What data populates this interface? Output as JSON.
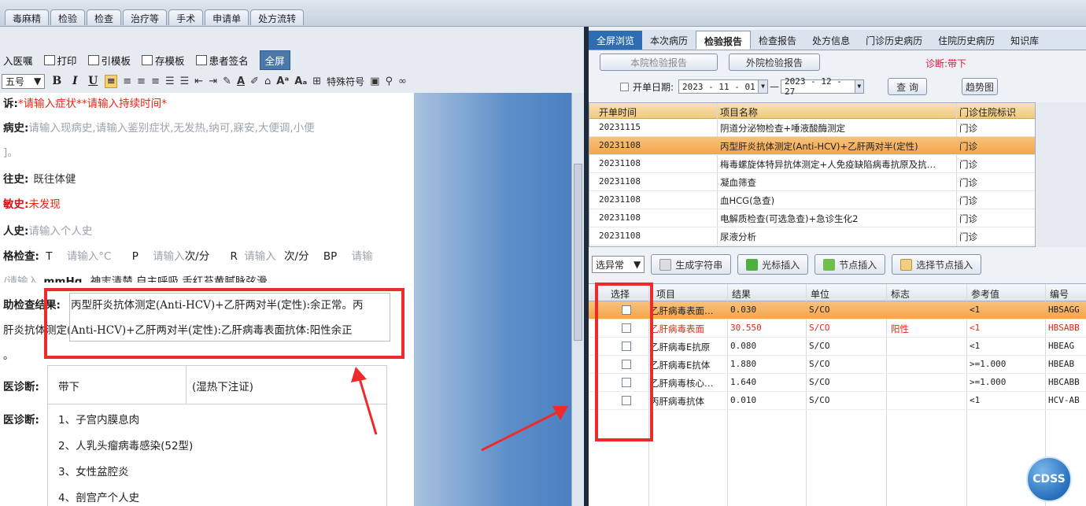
{
  "top_tabs": [
    "毒麻精",
    "检验",
    "检查",
    "治疗等",
    "手术",
    "申请单",
    "处方流转"
  ],
  "editor": {
    "toolbar1": {
      "import": "入医嘱",
      "print": "打印",
      "ref_template": "引模板",
      "save_template": "存模板",
      "patient_sign": "患者签名",
      "fullscreen": "全屏"
    },
    "font_size": "五号",
    "special_chars": "特殊符号",
    "complaint_label": "诉:",
    "complaint_value": "*请输入症状**请输入持续时间*",
    "present_label": "病史:",
    "present_text_1": "请输入现病史,请输入鉴别症状,无发热,纳可,寐安,大便调,小便",
    "present_text_2": "]。",
    "past_label": "往史:",
    "past_value": "既往体健",
    "allergy_label": "敏史:",
    "allergy_value": "未发现",
    "personal_label": "人史:",
    "personal_value": "请输入个人史",
    "exam_label": "格检查:",
    "exam_T": "T",
    "exam_T_input": "请输入",
    "exam_T_unit": "°C",
    "exam_P": "P",
    "exam_P_input": "请输入",
    "exam_P_unit": "次/分",
    "exam_R": "R",
    "exam_R_input": "请输入",
    "exam_R_unit": "次/分",
    "exam_BP": "BP",
    "exam_BP_input": "请输",
    "exam_line2_a": "/请输入",
    "exam_line2_b": "mmHg",
    "exam_line2_c": "神志清楚,自主呼吸,舌红苔黄腻脉弦滑。",
    "aux_label": "助检查结果:",
    "aux_line1": "丙型肝炎抗体测定(Anti-HCV)+乙肝两对半(定性):余正常。丙",
    "aux_line2": "肝炎抗体测定(Anti-HCV)+乙肝两对半(定性):乙肝病毒表面抗体:阳性余正",
    "aux_line3": "。",
    "dx1_label": "医诊断:",
    "dx1_value": "带下",
    "dx1_note": "(湿热下注证)",
    "dx2_label": "医诊断:",
    "dx2_items": [
      "1、子宫内膜息肉",
      "2、人乳头瘤病毒感染(52型)",
      "3、女性盆腔炎",
      "4、剖宫产个人史"
    ]
  },
  "right": {
    "tabs": [
      "全屏浏览",
      "本次病历",
      "检验报告",
      "检查报告",
      "处方信息",
      "门诊历史病历",
      "住院历史病历",
      "知识库"
    ],
    "btn_internal": "本院检验报告",
    "btn_external": "外院检验报告",
    "diagnosis": "诊断:带下",
    "date_label": "开单日期:",
    "date_from": "2023 - 11 - 01",
    "date_sep": "—",
    "date_to": "2023 - 12 - 27",
    "query": "查 询",
    "trend": "趋势图",
    "grid1_headers": [
      "开单时间",
      "项目名称",
      "门诊住院标识"
    ],
    "grid1_rows": [
      {
        "date": "20231115",
        "name": "阴道分泌物检查+唾液酸酶测定",
        "type": "门诊"
      },
      {
        "date": "20231108",
        "name": "丙型肝炎抗体测定(Anti-HCV)+乙肝两对半(定性)",
        "type": "门诊"
      },
      {
        "date": "20231108",
        "name": "梅毒螺旋体特异抗体测定+人免疫缺陷病毒抗原及抗…",
        "type": "门诊"
      },
      {
        "date": "20231108",
        "name": "凝血筛查",
        "type": "门诊"
      },
      {
        "date": "20231108",
        "name": "血HCG(急查)",
        "type": "门诊"
      },
      {
        "date": "20231108",
        "name": "电解质检查(可选急查)+急诊生化2",
        "type": "门诊"
      },
      {
        "date": "20231108",
        "name": "尿液分析",
        "type": "门诊"
      }
    ],
    "filter": "选异常",
    "btn_generate": "生成字符串",
    "btn_cursor": "光标插入",
    "btn_node": "节点插入",
    "btn_select_node": "选择节点插入",
    "grid2_headers": [
      "选择",
      "项目",
      "结果",
      "单位",
      "标志",
      "参考值",
      "编号"
    ],
    "grid2_rows": [
      {
        "item": "乙肝病毒表面…",
        "result": "0.030",
        "unit": "S/CO",
        "flag": "",
        "ref": "<1",
        "code": "HBSAGG"
      },
      {
        "item": "乙肝病毒表面",
        "result": "30.550",
        "unit": "S/CO",
        "flag": "阳性",
        "ref": "<1",
        "code": "HBSABB"
      },
      {
        "item": "乙肝病毒E抗原",
        "result": "0.080",
        "unit": "S/CO",
        "flag": "",
        "ref": "<1",
        "code": "HBEAG"
      },
      {
        "item": "乙肝病毒E抗体",
        "result": "1.880",
        "unit": "S/CO",
        "flag": "",
        "ref": ">=1.000",
        "code": "HBEAB"
      },
      {
        "item": "乙肝病毒核心…",
        "result": "1.640",
        "unit": "S/CO",
        "flag": "",
        "ref": ">=1.000",
        "code": "HBCABB"
      },
      {
        "item": "丙肝病毒抗体",
        "result": "0.010",
        "unit": "S/CO",
        "flag": "",
        "ref": "<1",
        "code": "HCV-AB"
      }
    ],
    "cdss": "CDSS"
  },
  "colors": {
    "alert_red": "#ee2a2a",
    "selected_row": "#f3a54a",
    "tab_blue": "#2e6db3"
  }
}
